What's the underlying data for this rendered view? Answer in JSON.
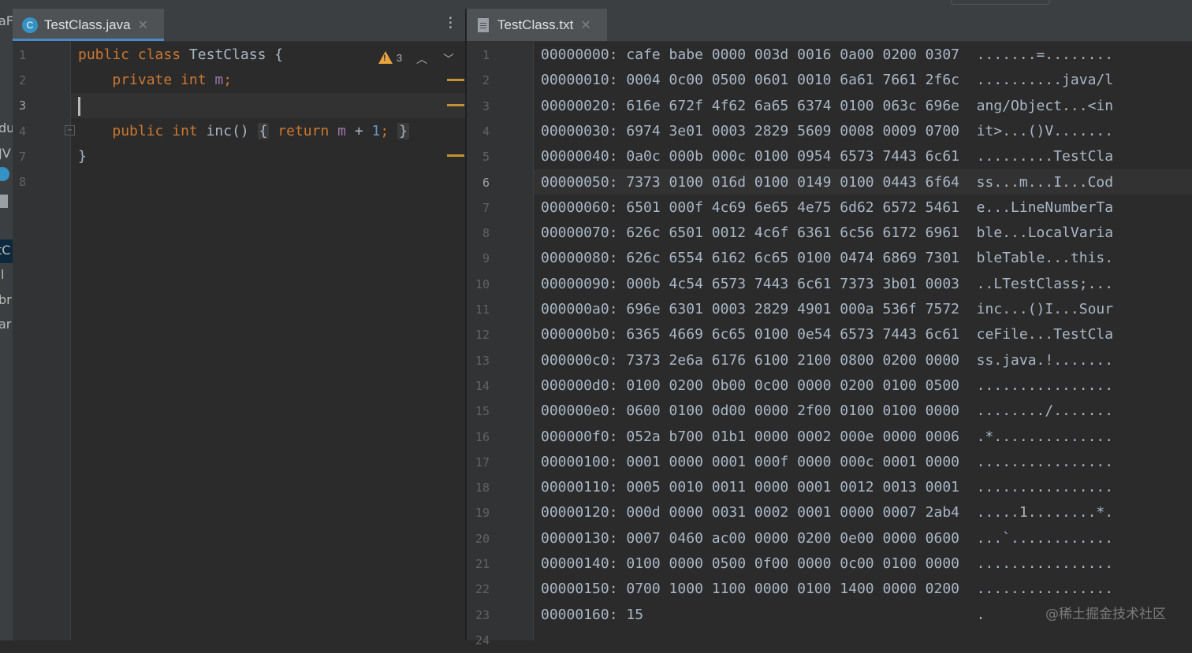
{
  "left_pane": {
    "tab": {
      "label": "TestClass.java",
      "icon": "java-class-icon",
      "icon_letter": "C"
    },
    "cut_project_text": [
      "aF",
      "du",
      "JV",
      "tC",
      "l",
      "br",
      "ar"
    ],
    "line_numbers": [
      "1",
      "2",
      "3",
      "4",
      "7",
      "8"
    ],
    "inspection": {
      "warning_count": "3"
    },
    "code_lines": [
      [
        {
          "t": "public",
          "c": "kw"
        },
        {
          "t": " "
        },
        {
          "t": "class",
          "c": "kw"
        },
        {
          "t": " TestClass {"
        }
      ],
      [
        {
          "t": "    "
        },
        {
          "t": "private",
          "c": "kw"
        },
        {
          "t": " "
        },
        {
          "t": "int",
          "c": "kw"
        },
        {
          "t": " "
        },
        {
          "t": "m",
          "c": "fld"
        },
        {
          "t": ";",
          "c": "kw"
        }
      ],
      [],
      [
        {
          "t": "    "
        },
        {
          "t": "public",
          "c": "kw"
        },
        {
          "t": " "
        },
        {
          "t": "int",
          "c": "kw"
        },
        {
          "t": " inc() "
        },
        {
          "t": "{",
          "c": "fbox"
        },
        {
          "t": " "
        },
        {
          "t": "return",
          "c": "kw"
        },
        {
          "t": " "
        },
        {
          "t": "m",
          "c": "fld"
        },
        {
          "t": " + "
        },
        {
          "t": "1",
          "c": "num"
        },
        {
          "t": ";",
          "c": "kw"
        },
        {
          "t": " "
        },
        {
          "t": "}",
          "c": "fbox"
        }
      ],
      [
        {
          "t": "}"
        }
      ],
      []
    ]
  },
  "right_pane": {
    "tab": {
      "label": "TestClass.txt",
      "icon": "text-file-icon"
    },
    "current_line": 6,
    "hex_lines": [
      "00000000: cafe babe 0000 003d 0016 0a00 0200 0307  .......=........",
      "00000010: 0004 0c00 0500 0601 0010 6a61 7661 2f6c  ..........java/l",
      "00000020: 616e 672f 4f62 6a65 6374 0100 063c 696e  ang/Object...<in",
      "00000030: 6974 3e01 0003 2829 5609 0008 0009 0700  it>...()V.......",
      "00000040: 0a0c 000b 000c 0100 0954 6573 7443 6c61  .........TestCla",
      "00000050: 7373 0100 016d 0100 0149 0100 0443 6f64  ss...m...I...Cod",
      "00000060: 6501 000f 4c69 6e65 4e75 6d62 6572 5461  e...LineNumberTa",
      "00000070: 626c 6501 0012 4c6f 6361 6c56 6172 6961  ble...LocalVaria",
      "00000080: 626c 6554 6162 6c65 0100 0474 6869 7301  bleTable...this.",
      "00000090: 000b 4c54 6573 7443 6c61 7373 3b01 0003  ..LTestClass;...",
      "000000a0: 696e 6301 0003 2829 4901 000a 536f 7572  inc...()I...Sour",
      "000000b0: 6365 4669 6c65 0100 0e54 6573 7443 6c61  ceFile...TestCla",
      "000000c0: 7373 2e6a 6176 6100 2100 0800 0200 0000  ss.java.!.......",
      "000000d0: 0100 0200 0b00 0c00 0000 0200 0100 0500  ................",
      "000000e0: 0600 0100 0d00 0000 2f00 0100 0100 0000  ......../.......",
      "000000f0: 052a b700 01b1 0000 0002 000e 0000 0006  .*..............",
      "00000100: 0001 0000 0001 000f 0000 000c 0001 0000  ................",
      "00000110: 0005 0010 0011 0000 0001 0012 0013 0001  ................",
      "00000120: 000d 0000 0031 0002 0001 0000 0007 2ab4  .....1........*.",
      "00000130: 0007 0460 ac00 0000 0200 0e00 0000 0600  ...`............",
      "00000140: 0100 0000 0500 0f00 0000 0c00 0100 0000  ................",
      "00000150: 0700 1000 1100 0000 0100 1400 0000 0200  ................",
      "00000160: 15                                       ."
    ],
    "line_numbers": [
      "1",
      "2",
      "3",
      "4",
      "5",
      "6",
      "7",
      "8",
      "9",
      "10",
      "11",
      "12",
      "13",
      "14",
      "15",
      "16",
      "17",
      "18",
      "19",
      "20",
      "21",
      "22",
      "23",
      "24"
    ]
  },
  "watermark": "@稀土掘金技术社区",
  "colors": {
    "keyword": "#cc7832",
    "field": "#9876aa",
    "number": "#6897bb",
    "accent": "#4a88c7",
    "warning": "#e8a33e"
  }
}
